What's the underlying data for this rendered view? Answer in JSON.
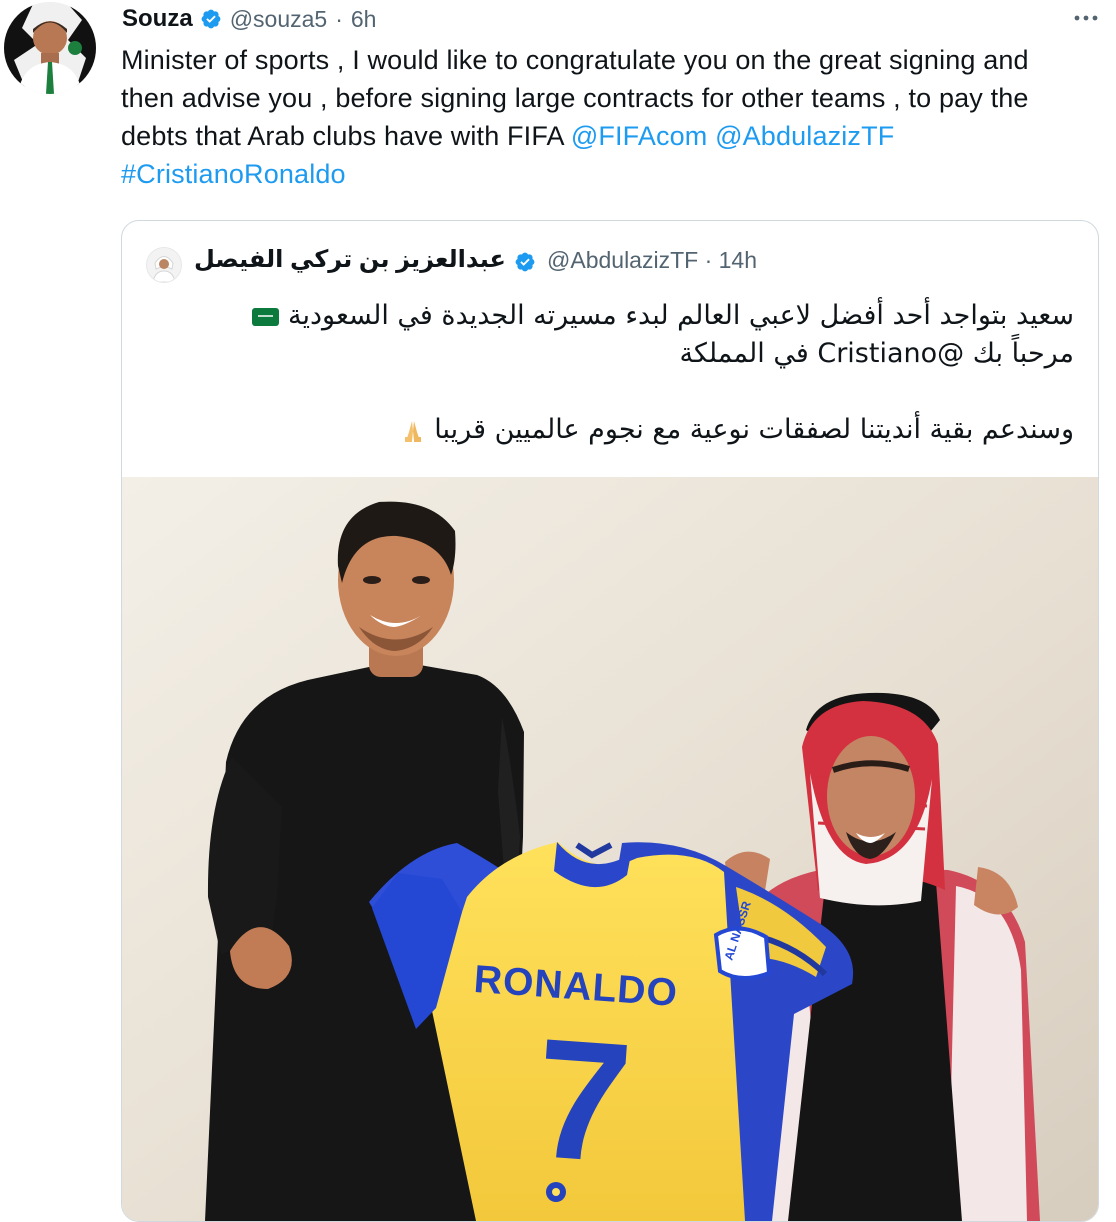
{
  "tweet": {
    "author": {
      "display_name": "Souza",
      "handle": "@souza5",
      "separator": "·",
      "time": "6h"
    },
    "text_lines": [
      "Minister of sports , I would like to congratulate you on the great signing and",
      "then advise you , before signing large contracts for other teams , to pay the",
      "debts that Arab clubs have with FIFA "
    ],
    "mentions": [
      "@FIFAcom",
      "@AbdulazizTF"
    ],
    "hashtag": "#CristianoRonaldo",
    "icons": [
      "verified-icon",
      "more-icon"
    ]
  },
  "quote": {
    "display_name": "عبدالعزيز بن تركي الفيصل",
    "handle": "@AbdulazizTF",
    "separator": "·",
    "time": "14h",
    "lines": [
      "سعيد بتواجد أحد أفضل لاعبي العالم لبدء مسيرته الجديدة في السعودية",
      "مرحباً بك @Cristiano في المملكة",
      "وسندعم بقية أنديتنا لصفقات نوعية مع نجوم عالميين قريبا"
    ],
    "photo": {
      "jersey_name": "RONALDO",
      "jersey_number": "7",
      "sleeve_text": "AL NASSR"
    },
    "emoji_icons": [
      "saudi-flag-icon",
      "folded-hands-icon"
    ]
  },
  "colors": {
    "link": "#1d9bf0",
    "text": "#0f1419",
    "muted": "#536471",
    "border": "#cfd9de",
    "verified": "#1d9bf0"
  }
}
